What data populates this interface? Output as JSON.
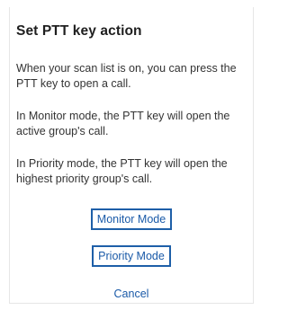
{
  "dialog": {
    "title": "Set PTT key action",
    "paragraphs": [
      "When your scan list is on, you can press the PTT key to open a call.",
      "In Monitor mode, the PTT key will open the active group's call.",
      "In Priority mode, the PTT key will open the highest priority group's call."
    ],
    "actions": {
      "monitor_mode": "Monitor Mode",
      "priority_mode": "Priority Mode",
      "cancel": "Cancel"
    }
  },
  "colors": {
    "accent": "#1a5aa8",
    "button_border": "#1e5fa8",
    "title_text": "#1f1f1f",
    "body_text": "#333333"
  }
}
